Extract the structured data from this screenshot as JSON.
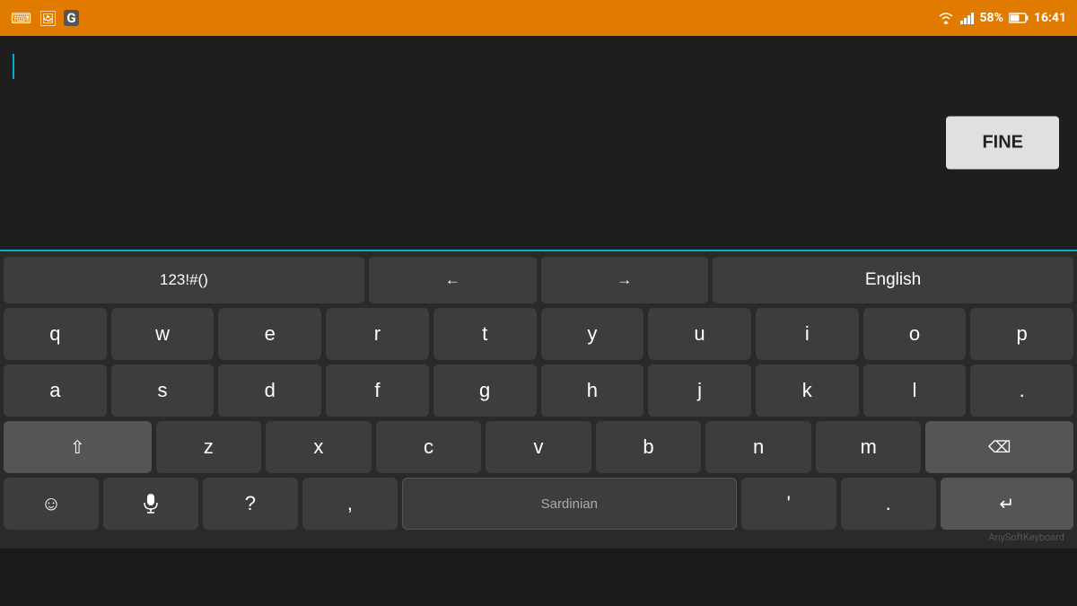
{
  "statusBar": {
    "battery": "58%",
    "time": "16:41",
    "icons": [
      "keyboard-icon",
      "image-icon",
      "grammarly-icon"
    ]
  },
  "textArea": {
    "fineButton": "FINE",
    "placeholder": ""
  },
  "keyboard": {
    "specialRow": {
      "numbers": "123!#()",
      "leftArrow": "←",
      "rightArrow": "→",
      "language": "English"
    },
    "row1": [
      "q",
      "w",
      "e",
      "r",
      "t",
      "y",
      "u",
      "i",
      "o",
      "p"
    ],
    "row2": [
      "a",
      "s",
      "d",
      "f",
      "g",
      "h",
      "j",
      "k",
      "l",
      "."
    ],
    "row3": [
      "z",
      "x",
      "c",
      "v",
      "b",
      "n",
      "m"
    ],
    "row4": {
      "emoji": "☺",
      "mic": "🎤",
      "question": "?",
      "comma": ",",
      "spacebar": "Sardinian",
      "apostrophe": "'",
      "dot": ".",
      "enter": "↵"
    },
    "shiftSymbol": "⇧",
    "backspaceSymbol": "⌫",
    "branding": "AnySoftKeyboard"
  }
}
